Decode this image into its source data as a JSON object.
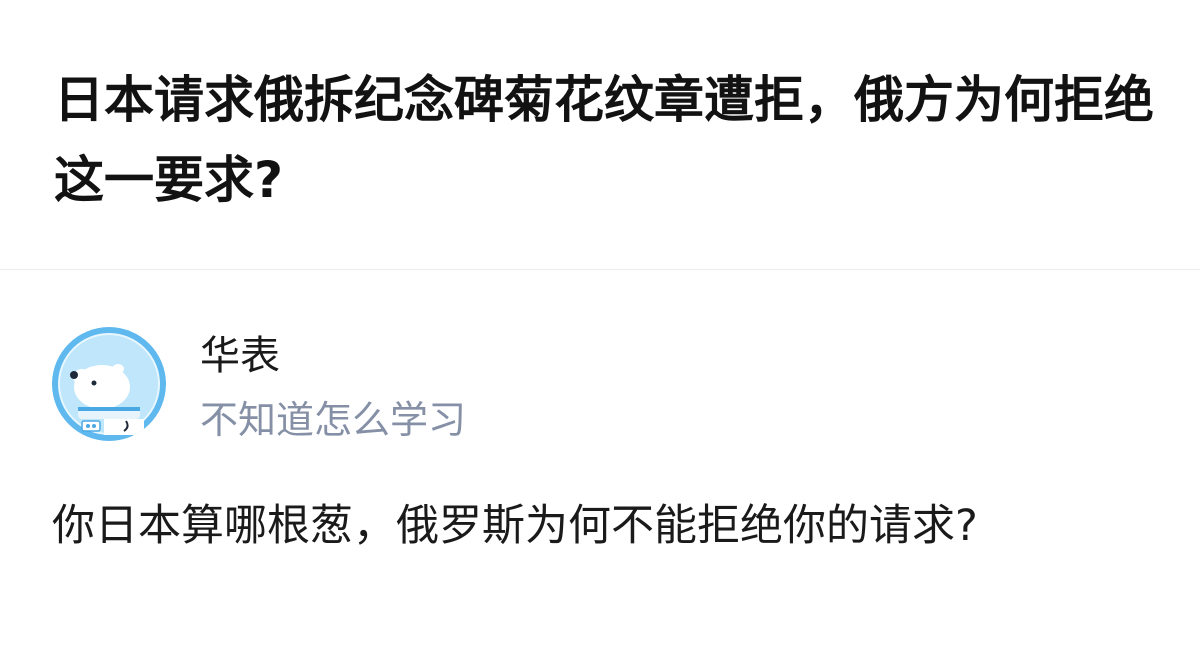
{
  "question": {
    "title": "日本请求俄拆纪念碑菊花纹章遭拒，俄方为何拒绝这一要求?"
  },
  "answer": {
    "author": {
      "name": "华表",
      "bio": "不知道怎么学习",
      "avatar_icon": "polar-bear-astronaut-avatar-icon"
    },
    "content": "你日本算哪根葱，俄罗斯为何不能拒绝你的请求?"
  },
  "colors": {
    "title": "#121212",
    "text": "#1a1a1a",
    "bio": "#8590a6",
    "divider": "#ececec",
    "avatar_bg": "#bfe3f6"
  }
}
